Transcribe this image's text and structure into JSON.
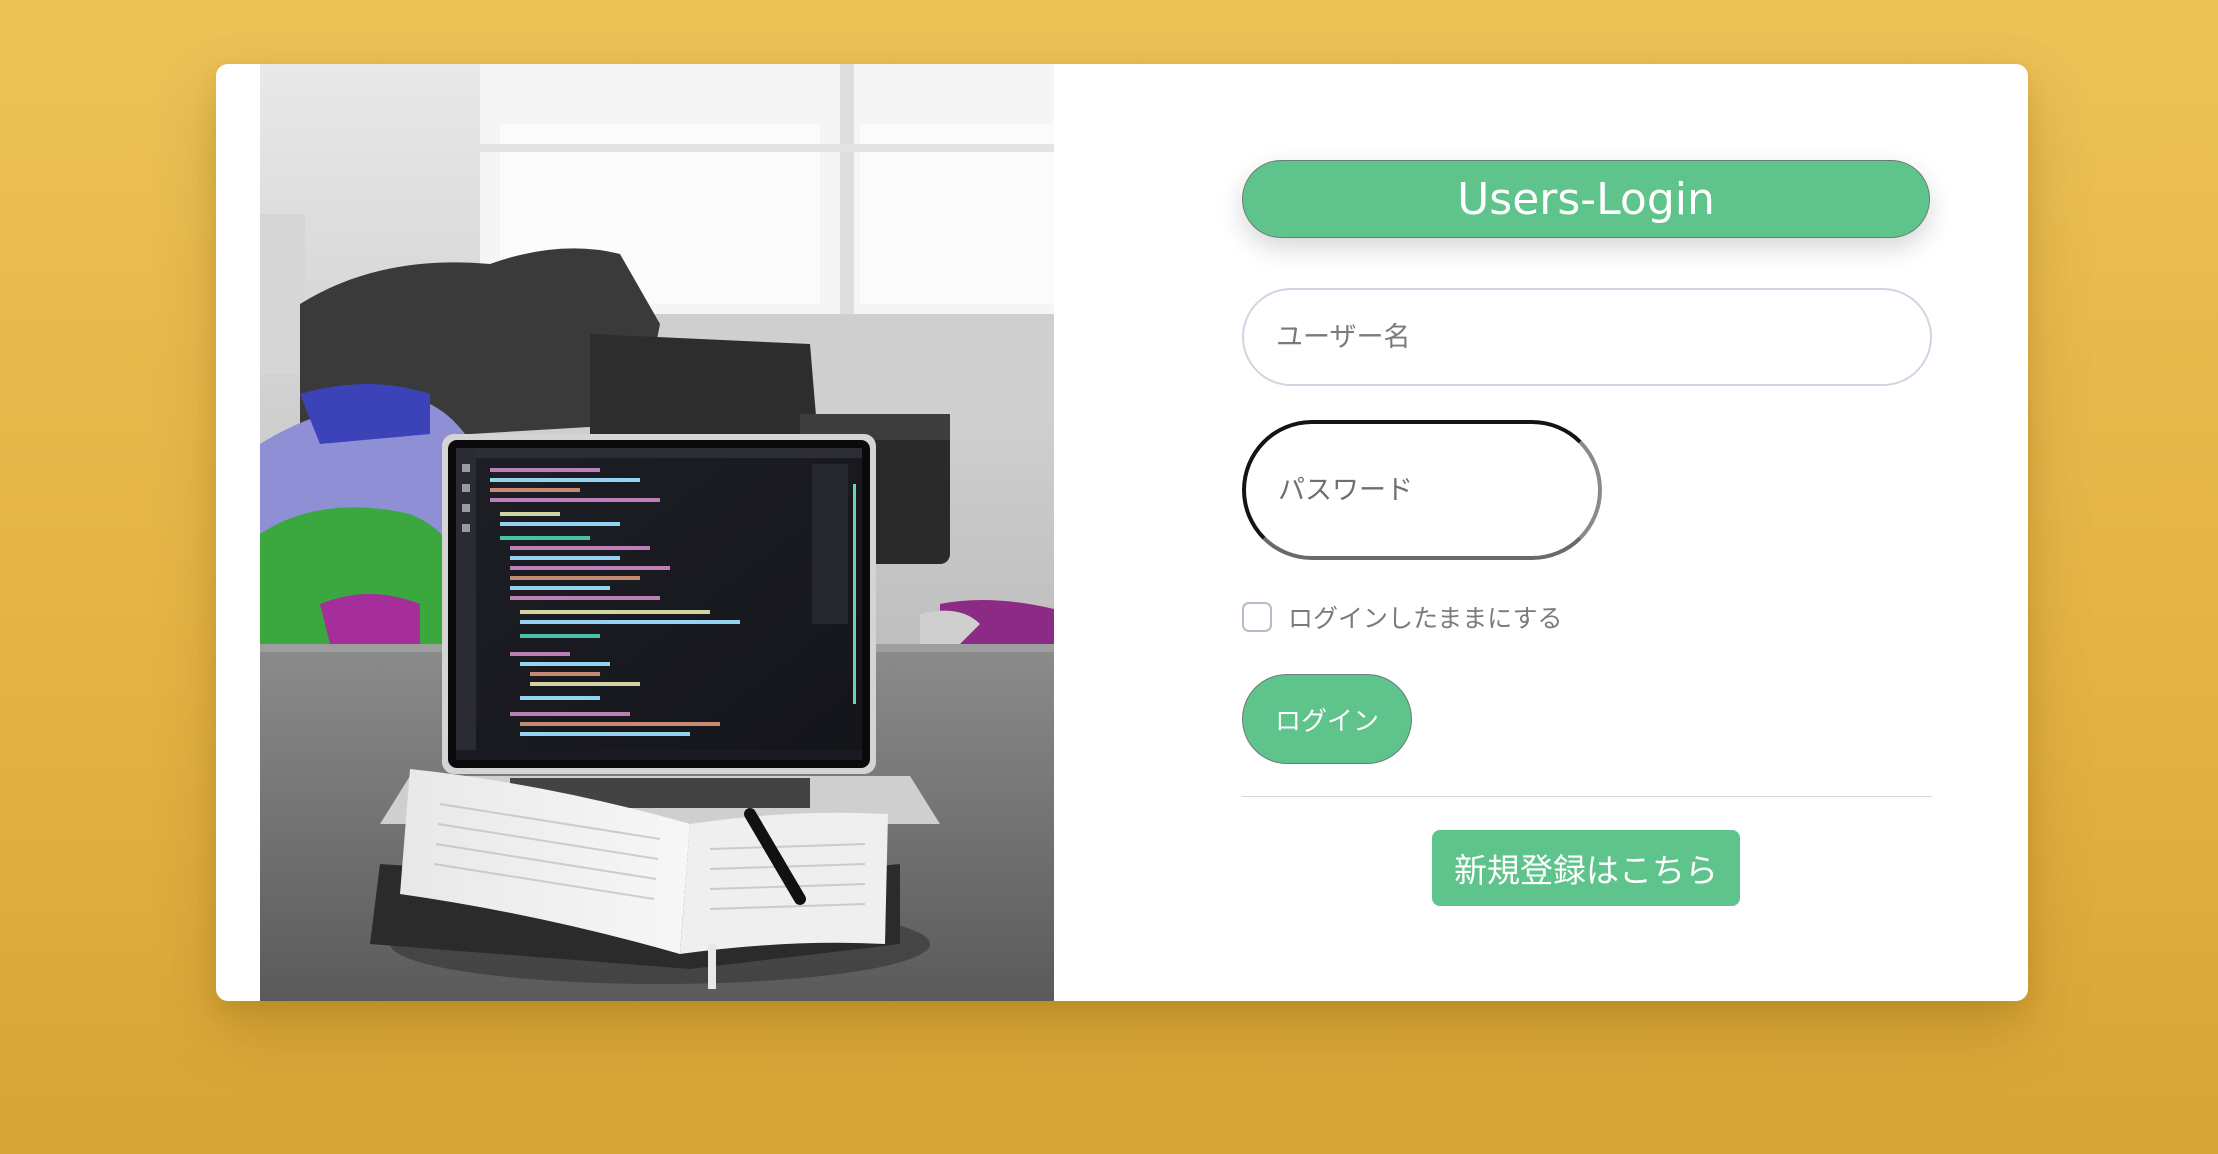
{
  "colors": {
    "background": "#e6b64a",
    "card": "#ffffff",
    "accent_green": "#5ec48c",
    "button_text": "#ffffff"
  },
  "hero_image": {
    "description_icon": "laptop-on-desk-photo"
  },
  "form": {
    "title": "Users-Login",
    "username": {
      "placeholder": "ユーザー名",
      "value": ""
    },
    "password": {
      "placeholder": "パスワード",
      "value": ""
    },
    "remember_me": {
      "label": "ログインしたままにする",
      "checked": false
    },
    "login_button": "ログイン",
    "register_button": "新規登録はこちら"
  }
}
